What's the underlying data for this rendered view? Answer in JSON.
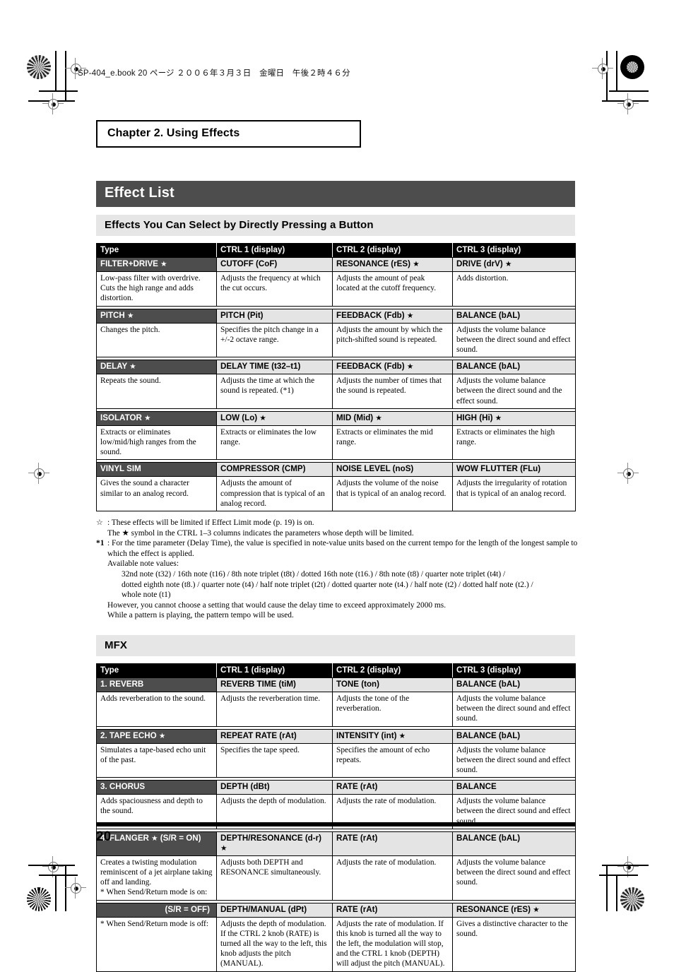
{
  "page": {
    "slug": "SP-404_e.book  20 ページ  ２００６年３月３日　金曜日　午後２時４６分",
    "chapter": "Chapter 2. Using Effects",
    "h1": "Effect List",
    "section1_title": "Effects You Can Select by Directly Pressing a Button",
    "section2_title": "MFX",
    "page_number": "20"
  },
  "table1": {
    "headers": [
      "Type",
      "CTRL 1 (display)",
      "CTRL 2 (display)",
      "CTRL 3 (display)"
    ],
    "rows": [
      {
        "params": [
          "FILTER+DRIVE ★",
          "CUTOFF (CoF)",
          "RESONANCE (rES) ★",
          "DRIVE (drV) ★"
        ],
        "descs": [
          "Low-pass filter with overdrive. Cuts the high range and adds distortion.",
          "Adjusts the frequency at which the cut occurs.",
          "Adjusts the amount of peak located at the cutoff frequency.",
          "Adds distortion."
        ]
      },
      {
        "params": [
          "PITCH ★",
          "PITCH (Pit)",
          "FEEDBACK (Fdb) ★",
          "BALANCE (bAL)"
        ],
        "descs": [
          "Changes the pitch.",
          "Specifies the pitch change in a +/-2 octave range.",
          "Adjusts the amount by which the pitch-shifted sound is repeated.",
          "Adjusts the volume balance between the direct sound and effect sound."
        ]
      },
      {
        "params": [
          "DELAY ★",
          "DELAY TIME (t32–t1)",
          "FEEDBACK (Fdb) ★",
          "BALANCE (bAL)"
        ],
        "descs": [
          "Repeats the sound.",
          "Adjusts the time at which the sound is repeated. (*1)",
          "Adjusts the number of times that the sound is repeated.",
          "Adjusts the volume balance between the direct sound and the effect sound."
        ]
      },
      {
        "params": [
          "ISOLATOR ★",
          "LOW (Lo) ★",
          "MID (Mid) ★",
          "HIGH (Hi) ★"
        ],
        "descs": [
          "Extracts or eliminates low/mid/high ranges from the sound.",
          "Extracts or eliminates the low range.",
          "Extracts or eliminates the mid range.",
          "Extracts or eliminates the high range."
        ]
      },
      {
        "params": [
          "VINYL SIM",
          "COMPRESSOR (CMP)",
          "NOISE LEVEL (noS)",
          "WOW FLUTTER (FLu)"
        ],
        "descs": [
          "Gives the sound a character similar to an analog record.",
          "Adjusts the amount of compression that is typical of an analog record.",
          "Adjusts the volume of the noise that is typical of an analog record.",
          "Adjusts the irregularity of rotation that is typical of an analog record."
        ]
      }
    ]
  },
  "notes": {
    "star_key": "☆",
    "star_line1": ": These effects will be limited if Effect Limit mode (p. 19) is on.",
    "star_line2": "The ★ symbol in the CTRL 1–3 columns indicates the parameters whose depth will be limited.",
    "n1_key": "*1",
    "n1_line1": ": For the time parameter (Delay Time), the value is specified in note-value units based on the current tempo for the length of the longest sample to which the effect is applied.",
    "n1_line2": "Available note values:",
    "n1_values1": "32nd note (t32) / 16th note (t16) / 8th note triplet (t8t) / dotted 16th note (t16.) / 8th note (t8) / quarter note triplet (t4t) /",
    "n1_values2": "dotted eighth note (t8.) / quarter note (t4) / half note triplet (t2t) / dotted quarter note (t4.) / half note (t2) / dotted half note (t2.) /",
    "n1_values3": "whole note (t1)",
    "n1_line3": "However, you cannot choose a setting that would cause the delay time to exceed approximately 2000 ms.",
    "n1_line4": "While a pattern is playing, the pattern tempo will be used."
  },
  "table2": {
    "headers": [
      "Type",
      "CTRL 1 (display)",
      "CTRL 2 (display)",
      "CTRL 3 (display)"
    ],
    "rows": [
      {
        "params": [
          "1. REVERB",
          "REVERB TIME (tiM)",
          "TONE (ton)",
          "BALANCE (bAL)"
        ],
        "descs": [
          "Adds reverberation to the sound.",
          "Adjusts the reverberation time.",
          "Adjusts the tone of the reverberation.",
          "Adjusts the volume balance between the direct sound and effect sound."
        ]
      },
      {
        "params": [
          "2. TAPE ECHO ★",
          "REPEAT RATE (rAt)",
          "INTENSITY (int) ★",
          "BALANCE (bAL)"
        ],
        "descs": [
          "Simulates a tape-based echo unit of the past.",
          "Specifies the tape speed.",
          "Specifies the amount of echo repeats.",
          "Adjusts the volume balance between the direct sound and effect sound."
        ]
      },
      {
        "params": [
          "3. CHORUS",
          "DEPTH (dBt)",
          "RATE (rAt)",
          "BALANCE"
        ],
        "descs": [
          "Adds spaciousness and depth to the sound.",
          "Adjusts the depth of modulation.",
          "Adjusts the rate of modulation.",
          "Adjusts the volume balance between the direct sound and effect sound."
        ]
      },
      {
        "params": [
          "4. FLANGER ★  (S/R = ON)",
          "DEPTH/RESONANCE (d-r) ★",
          "RATE (rAt)",
          "BALANCE (bAL)"
        ],
        "descs": [
          "Creates a twisting modulation reminiscent of a jet airplane taking off and landing.\n* When Send/Return mode is on:",
          "Adjusts both DEPTH and RESONANCE simultaneously.",
          "Adjusts the rate of modulation.",
          "Adjusts the volume balance between the direct sound and effect sound."
        ]
      },
      {
        "params": [
          "(S/R = OFF)",
          "DEPTH/MANUAL (dPt)",
          "RATE (rAt)",
          "RESONANCE (rES) ★"
        ],
        "type_align": "right",
        "descs": [
          "* When Send/Return mode is off:",
          "Adjusts the depth of modulation. If the CTRL 2 knob (RATE) is turned all the way to the left, this knob adjusts the pitch (MANUAL).",
          "Adjusts the rate of modulation. If this knob is turned all the way to the left, the modulation will stop, and the CTRL 1 knob (DEPTH) will adjust the pitch (MANUAL).",
          "Gives a distinctive character to the sound."
        ]
      }
    ]
  }
}
